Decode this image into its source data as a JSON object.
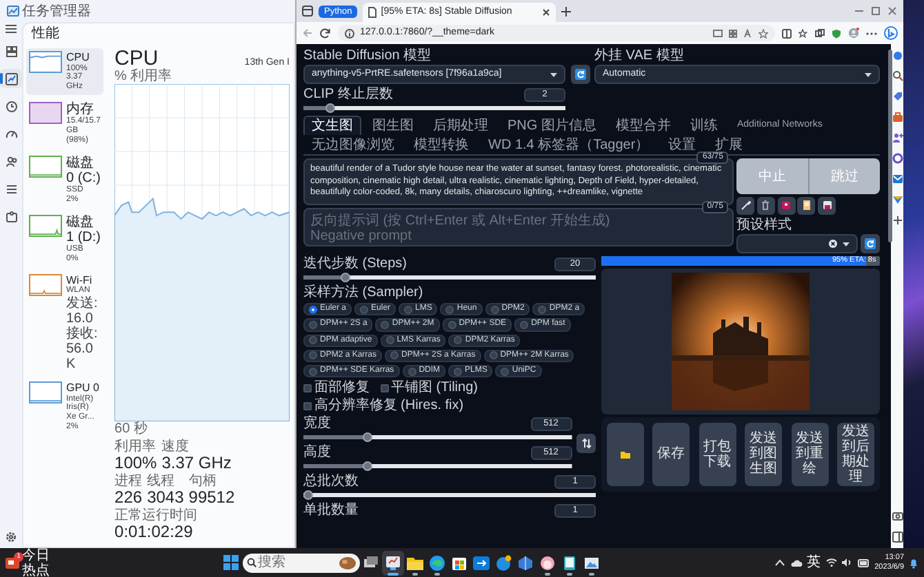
{
  "task_manager": {
    "title": "任务管理器",
    "section_title": "性能",
    "nav_rail": [
      {
        "selected": false
      },
      {
        "selected": true
      },
      {
        "selected": false
      },
      {
        "selected": false
      },
      {
        "selected": false
      },
      {
        "selected": false
      },
      {
        "selected": false
      }
    ],
    "resources": [
      {
        "name": "CPU",
        "details": [
          "100% 3.37 GHz"
        ],
        "selected": true,
        "color": "#5b9bd5"
      },
      {
        "name": "内存",
        "details": [
          "15.4/15.7 GB (98%)"
        ],
        "selected": false,
        "color": "#a35ec2"
      },
      {
        "name": "磁盘 0 (C:)",
        "details": [
          "SSD",
          "2%"
        ],
        "selected": false,
        "color": "#5fb04c"
      },
      {
        "name": "磁盘 1 (D:)",
        "details": [
          "USB",
          "0%"
        ],
        "selected": false,
        "color": "#5fb04c"
      },
      {
        "name": "Wi-Fi",
        "details": [
          "WLAN",
          "发送: 16.0 接收: 56.0 K"
        ],
        "selected": false,
        "color": "#d98a3a"
      },
      {
        "name": "GPU 0",
        "details": [
          "Intel(R) Iris(R) Xe Gr...",
          "2%"
        ],
        "selected": false,
        "color": "#5b9bd5"
      }
    ],
    "detail": {
      "title": "CPU",
      "model": "13th Gen I",
      "chart_label": "% 利用率",
      "time_label": "60 秒",
      "stat_rows": [
        [
          {
            "label": "利用率",
            "value": "100%"
          },
          {
            "label": "速度",
            "value": "3.37 GHz"
          }
        ],
        [
          {
            "label": "进程",
            "value": "226"
          },
          {
            "label": "线程",
            "value": "3043"
          },
          {
            "label": "句柄",
            "value": "99512"
          }
        ],
        [
          {
            "label": "正常运行时间",
            "value": "0:01:02:29"
          }
        ]
      ]
    }
  },
  "browser": {
    "tab_group": "Python",
    "tab_title": "[95% ETA: 8s] Stable Diffusion",
    "address": "127.0.0.1:7860/?__theme=dark"
  },
  "webui": {
    "model": {
      "label": "Stable Diffusion 模型",
      "value": "anything-v5-PrtRE.safetensors [7f96a1a9ca]"
    },
    "vae": {
      "label": "外挂 VAE 模型",
      "value": "Automatic"
    },
    "clip_skip": {
      "label": "CLIP 终止层数",
      "value": "2",
      "level": 0.09
    },
    "tabs": [
      {
        "label": "文生图",
        "selected": true
      },
      {
        "label": "图生图",
        "selected": false
      },
      {
        "label": "后期处理",
        "selected": false
      },
      {
        "label": "PNG 图片信息",
        "selected": false
      },
      {
        "label": "模型合并",
        "selected": false
      },
      {
        "label": "训练",
        "selected": false
      },
      {
        "label": "Additional Networks",
        "selected": false
      },
      {
        "label": "无边图像浏览",
        "selected": false
      },
      {
        "label": "模型转换",
        "selected": false
      },
      {
        "label": "WD 1.4 标签器（Tagger）",
        "selected": false
      },
      {
        "label": "设置",
        "selected": false
      },
      {
        "label": "扩展",
        "selected": false
      }
    ],
    "prompt": {
      "value": "beautiful render of a Tudor style house near the water at sunset, fantasy forest. photorealistic, cinematic composition, cinematic high detail, ultra realistic, cinematic lighting, Depth of Field, hyper-detailed, beautifully color-coded, 8k, many details, chiaroscuro lighting, ++dreamlike, vignette",
      "counter": "63/75"
    },
    "negative_prompt": {
      "placeholder": "反向提示词 (按 Ctrl+Enter 或 Alt+Enter 开始生成)\nNegative prompt",
      "counter": "0/75"
    },
    "actions": [
      "中止",
      "跳过"
    ],
    "styles": {
      "label": "预设样式"
    },
    "steps": {
      "label": "迭代步数 (Steps)",
      "value": "20",
      "level": 0.13
    },
    "sampler": {
      "label": "采样方法 (Sampler)",
      "options": [
        {
          "label": "Euler a",
          "selected": true
        },
        {
          "label": "Euler",
          "selected": false
        },
        {
          "label": "LMS",
          "selected": false
        },
        {
          "label": "Heun",
          "selected": false
        },
        {
          "label": "DPM2",
          "selected": false
        },
        {
          "label": "DPM2 a",
          "selected": false
        },
        {
          "label": "DPM++ 2S a",
          "selected": false
        },
        {
          "label": "DPM++ 2M",
          "selected": false
        },
        {
          "label": "DPM++ SDE",
          "selected": false
        },
        {
          "label": "DPM fast",
          "selected": false
        },
        {
          "label": "DPM adaptive",
          "selected": false
        },
        {
          "label": "LMS Karras",
          "selected": false
        },
        {
          "label": "DPM2 Karras",
          "selected": false
        },
        {
          "label": "DPM2 a Karras",
          "selected": false
        },
        {
          "label": "DPM++ 2S a Karras",
          "selected": false
        },
        {
          "label": "DPM++ 2M Karras",
          "selected": false
        },
        {
          "label": "DPM++ SDE Karras",
          "selected": false
        },
        {
          "label": "DDIM",
          "selected": false
        },
        {
          "label": "PLMS",
          "selected": false
        },
        {
          "label": "UniPC",
          "selected": false
        }
      ]
    },
    "options": [
      {
        "label": "面部修复",
        "checked": false
      },
      {
        "label": "平铺图 (Tiling)",
        "checked": false
      },
      {
        "label": "高分辨率修复 (Hires. fix)",
        "checked": false
      }
    ],
    "width": {
      "label": "宽度",
      "value": "512",
      "level": 0.23
    },
    "height": {
      "label": "高度",
      "value": "512",
      "level": 0.23
    },
    "batch_count": {
      "label": "总批次数",
      "value": "1",
      "level": 0
    },
    "batch_size": {
      "label": "单批数量",
      "value": "1"
    },
    "progress": {
      "text": "95% ETA: 8s",
      "level": 0.95
    },
    "gallery_buttons": [
      {
        "kind": "icon"
      },
      {
        "kind": "text",
        "label": "保存"
      },
      {
        "kind": "text",
        "label": "打包下载"
      },
      {
        "kind": "text",
        "label": "发送到图生图"
      },
      {
        "kind": "text",
        "label": "发送到重绘"
      },
      {
        "kind": "text",
        "label": "发送到后期处理"
      }
    ]
  },
  "taskbar": {
    "widget": {
      "badge": "1",
      "text": "今日热点"
    },
    "search": {
      "placeholder": "搜索"
    },
    "apps": [
      {
        "running": false,
        "active": false
      },
      {
        "running": true,
        "active": true
      },
      {
        "running": true,
        "active": false
      },
      {
        "running": true,
        "active": false
      },
      {
        "running": false,
        "active": false
      },
      {
        "running": false,
        "active": false
      },
      {
        "running": false,
        "active": false
      },
      {
        "running": false,
        "active": false
      },
      {
        "running": true,
        "active": false
      },
      {
        "running": true,
        "active": false
      },
      {
        "running": true,
        "active": false
      }
    ],
    "ime": "英",
    "clock": {
      "time": "13:07",
      "date": "2023/6/9"
    }
  }
}
